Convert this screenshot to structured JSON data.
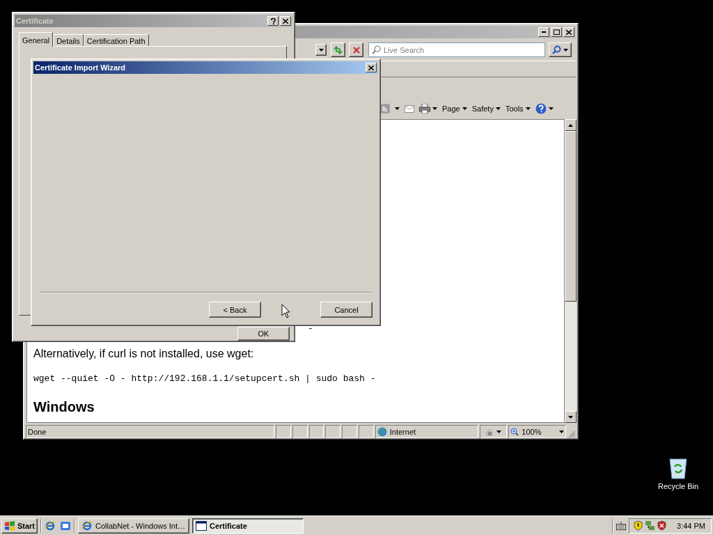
{
  "browser_window": {
    "search": {
      "placeholder": "Live Search"
    },
    "command_bar": [
      "Page",
      "Safety",
      "Tools"
    ],
    "content": {
      "fragment": "-",
      "paragraph": "Alternatively, if curl is not installed, use wget:",
      "code": "wget --quiet -O - http://192.168.1.1/setupcert.sh | sudo bash -",
      "heading": "Windows"
    },
    "status_bar": {
      "status": "Done",
      "zone": "Internet",
      "zoom": "100%"
    }
  },
  "certificate_dialog": {
    "title": "Certificate",
    "tabs": [
      {
        "label": "General",
        "selected": true
      },
      {
        "label": "Details",
        "selected": false
      },
      {
        "label": "Certification Path",
        "selected": false
      }
    ],
    "buttons": [
      "OK"
    ]
  },
  "wizard": {
    "title": "Certificate Import Wizard",
    "buttons": [
      "< Back",
      "Cancel"
    ]
  },
  "desktop_icons": [
    {
      "label": "Recycle Bin"
    }
  ],
  "taskbar": {
    "start": "Start",
    "tasks": [
      {
        "label": "CollabNet - Windows Int…",
        "selected": false
      },
      {
        "label": "Certificate",
        "selected": true
      }
    ],
    "clock": "3:44 PM"
  }
}
